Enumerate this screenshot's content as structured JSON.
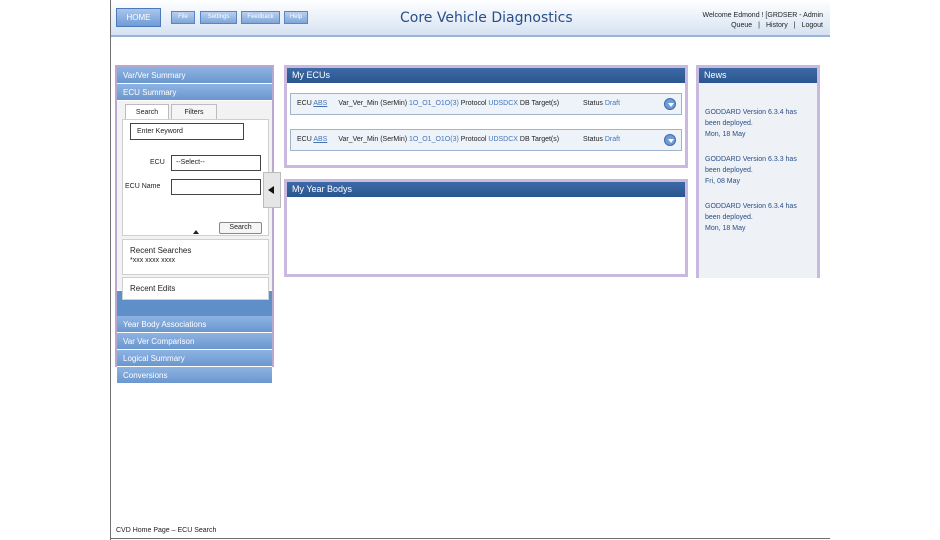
{
  "header": {
    "home_label": "HOME",
    "nav": [
      "File",
      "Settings",
      "Feedback",
      "Help"
    ],
    "title": "Core Vehicle Diagnostics",
    "welcome": "Welcome Edmond ! [GRDSER - Admin",
    "links": [
      "Queue",
      "History",
      "Logout"
    ]
  },
  "sidebar": {
    "top_items": [
      "Var/Ver Summary",
      "ECU Summary"
    ],
    "tabs": [
      "Search",
      "Filters"
    ],
    "keyword_placeholder": "Enter Keyword",
    "ecu_label": "ECU",
    "ecu_select": "--Select--",
    "ecu_name_label": "ECU Name",
    "search_button": "Search",
    "recent_searches_title": "Recent Searches",
    "recent_searches_value": "*xxx xxxx xxxx",
    "recent_edits_title": "Recent Edits",
    "bottom_items": [
      "Year Body Associations",
      "Var Ver Comparison",
      "Logical Summary",
      "Conversions"
    ]
  },
  "my_ecus": {
    "title": "My ECUs",
    "rows": [
      {
        "ecu_label": "ECU",
        "ecu_value": "ABS",
        "var_label": "Var_Ver_Min (SerMin)",
        "var_value": "1O_O1_O1O(3)",
        "protocol_label": "Protocol",
        "protocol_value": "UDSDCX",
        "db_label": "DB Target(s)",
        "status_label": "Status",
        "status_value": "Draft"
      },
      {
        "ecu_label": "ECU",
        "ecu_value": "ABS",
        "var_label": "Var_Ver_Min (SerMin)",
        "var_value": "1O_O1_O1O(3)",
        "protocol_label": "Protocol",
        "protocol_value": "UDSDCX",
        "db_label": "DB Target(s)",
        "status_label": "Status",
        "status_value": "Draft"
      }
    ]
  },
  "my_year_bodys": {
    "title": "My Year Bodys"
  },
  "news": {
    "title": "News",
    "items": [
      {
        "text": "GODDARD Version 6.3.4 has been deployed.",
        "date": "Mon, 18 May"
      },
      {
        "text": "GODDARD Version 6.3.3 has been deployed.",
        "date": "Fri, 08 May"
      },
      {
        "text": "GODDARD Version 6.3.4 has been deployed.",
        "date": "Mon, 18 May"
      }
    ]
  },
  "footer": {
    "text": "CVD Home Page – ECU Search"
  }
}
